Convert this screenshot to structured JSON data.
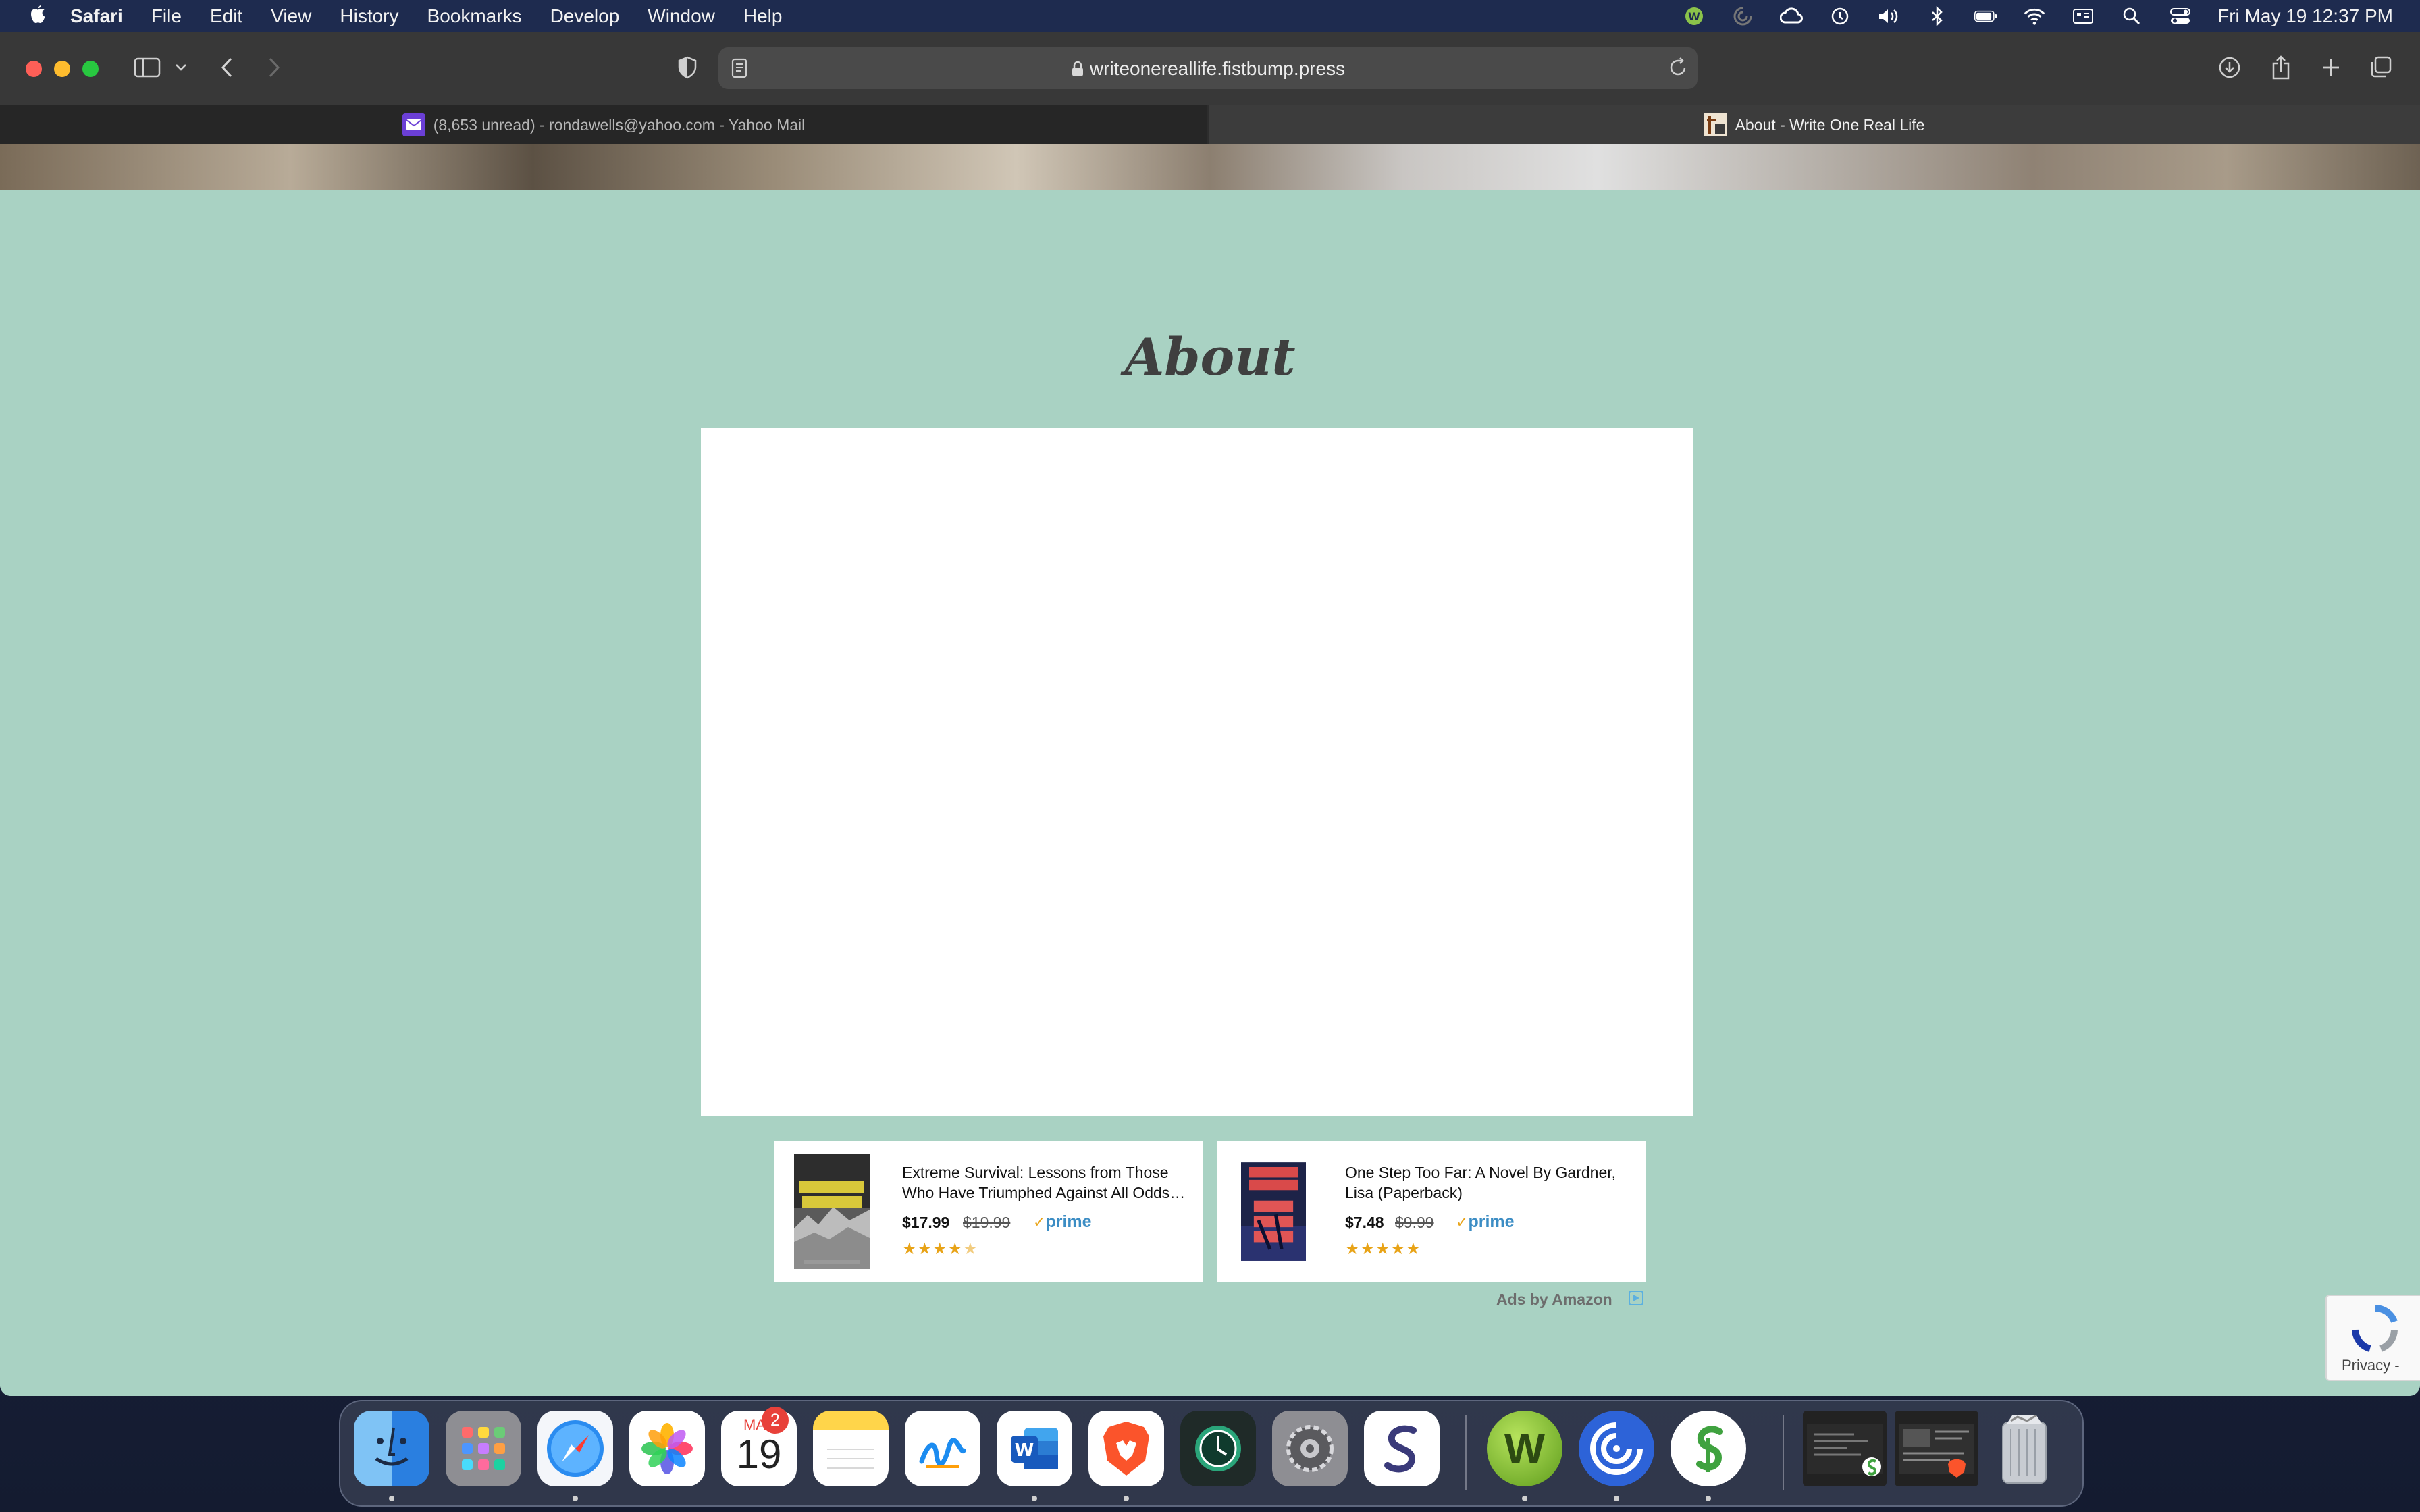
{
  "menubar": {
    "app_name": "Safari",
    "items": [
      "File",
      "Edit",
      "View",
      "History",
      "Bookmarks",
      "Develop",
      "Window",
      "Help"
    ],
    "clock": "Fri May 19  12:37 PM"
  },
  "toolbar": {
    "url": "writeonereallife.fistbump.press"
  },
  "tabs": [
    {
      "label": "(8,653 unread) - rondawells@yahoo.com - Yahoo Mail"
    },
    {
      "label": "About - Write One Real Life"
    }
  ],
  "page": {
    "title": "About"
  },
  "ads": [
    {
      "title": "Extreme Survival: Lessons from Those Who Have Triumphed Against All Odds…",
      "price": "$17.99",
      "old_price": "$19.99",
      "prime": "prime",
      "rating": 4.5
    },
    {
      "title": "One Step Too Far: A Novel By Gardner, Lisa (Paperback)",
      "price": "$7.48",
      "old_price": "$9.99",
      "prime": "prime",
      "rating": 5
    }
  ],
  "ads_by": "Ads by Amazon",
  "recaptcha": {
    "label": "Privacy -"
  },
  "dock": {
    "calendar_month": "MAY",
    "calendar_day": "19",
    "calendar_badge": "2"
  },
  "colors": {
    "page_bg": "#a9d2c3",
    "prime_blue": "#3c8dc4",
    "star_gold": "#e8a317"
  }
}
